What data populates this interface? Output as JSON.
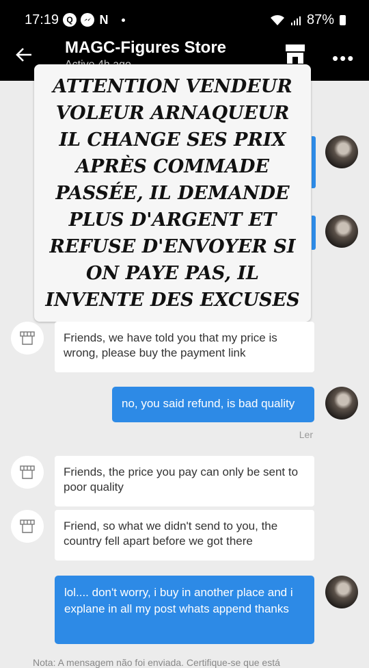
{
  "status_bar": {
    "time": "17:19",
    "app_icon_q": "Q",
    "app_icon_n": "N",
    "battery": "87%",
    "icons": [
      "messenger-icon",
      "wifi-icon",
      "signal-icon",
      "battery-icon"
    ]
  },
  "header": {
    "title": "MAGC-Figures Store",
    "subtitle": "Active 4h ago"
  },
  "overlay_text": "ATTENTION VENDEUR VOLEUR ARNAQUEUR IL CHANGE SES PRIX APRÈS COMMADE PASSÉE, IL DEMANDE PLUS D'ARGENT ET REFUSE D'ENVOYER SI ON PAYE PAS, IL INVENTE DES EXCUSES",
  "messages": [
    {
      "from": "shop",
      "text": "Friends, we have told you that my price is wrong, please buy the payment link"
    },
    {
      "from": "me",
      "text": "no, you said refund, is bad quality"
    },
    {
      "from": "shop",
      "text": "Friends, the price you pay can only be sent to poor quality"
    },
    {
      "from": "shop",
      "text": "Friend, so what we didn't send to you, the country fell apart before we got there"
    },
    {
      "from": "me",
      "text": "lol.... don't worry, i buy in another place and i explane in all my post whats append thanks"
    }
  ],
  "read_label": "Ler",
  "footer_note": "Nota: A mensagem não foi enviada. Certifique-se que está"
}
